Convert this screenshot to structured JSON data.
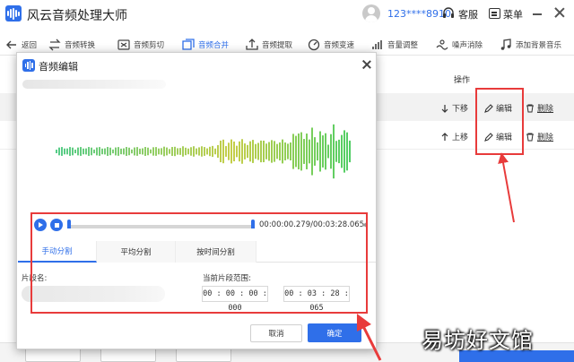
{
  "app": {
    "title": "风云音频处理大师",
    "user_phone": "123****8910",
    "service_label": "客服",
    "menu_label": "菜单"
  },
  "toolbar": {
    "back_label": "返回",
    "items": [
      {
        "label": "音频转换",
        "icon": "convert-icon"
      },
      {
        "label": "音频剪切",
        "icon": "scissors-icon"
      },
      {
        "label": "音频合并",
        "icon": "merge-icon",
        "active": true
      },
      {
        "label": "音频提取",
        "icon": "extract-icon"
      },
      {
        "label": "音频变速",
        "icon": "speed-icon"
      },
      {
        "label": "音量调整",
        "icon": "volume-adjust-icon"
      },
      {
        "label": "噪声消除",
        "icon": "noise-icon"
      },
      {
        "label": "添加背景音乐",
        "icon": "music-icon"
      }
    ]
  },
  "table": {
    "operation_header": "操作",
    "rows": [
      {
        "move_label": "下移",
        "edit_label": "编辑",
        "delete_label": "删除"
      },
      {
        "move_label": "上移",
        "edit_label": "编辑",
        "delete_label": "删除"
      }
    ]
  },
  "dialog": {
    "title": "音频编辑",
    "time_readout": "00:00:00.279/00:03:28.065",
    "tabs": [
      "手动分割",
      "平均分割",
      "按时间分割"
    ],
    "segment_name_label": "片段名:",
    "range_label": "当前片段范围:",
    "range_start": "00 : 00 : 00 : 000",
    "range_end": "00 : 03 : 28 : 065",
    "cancel_label": "取消",
    "ok_label": "确定"
  },
  "watermark": "易坊好文馆",
  "colors": {
    "accent": "#2f6fe9",
    "annotation": "#e83b3b",
    "wave_start": "#2bc06a",
    "wave_mid": "#b7c11b",
    "wave_end": "#27c23f"
  }
}
